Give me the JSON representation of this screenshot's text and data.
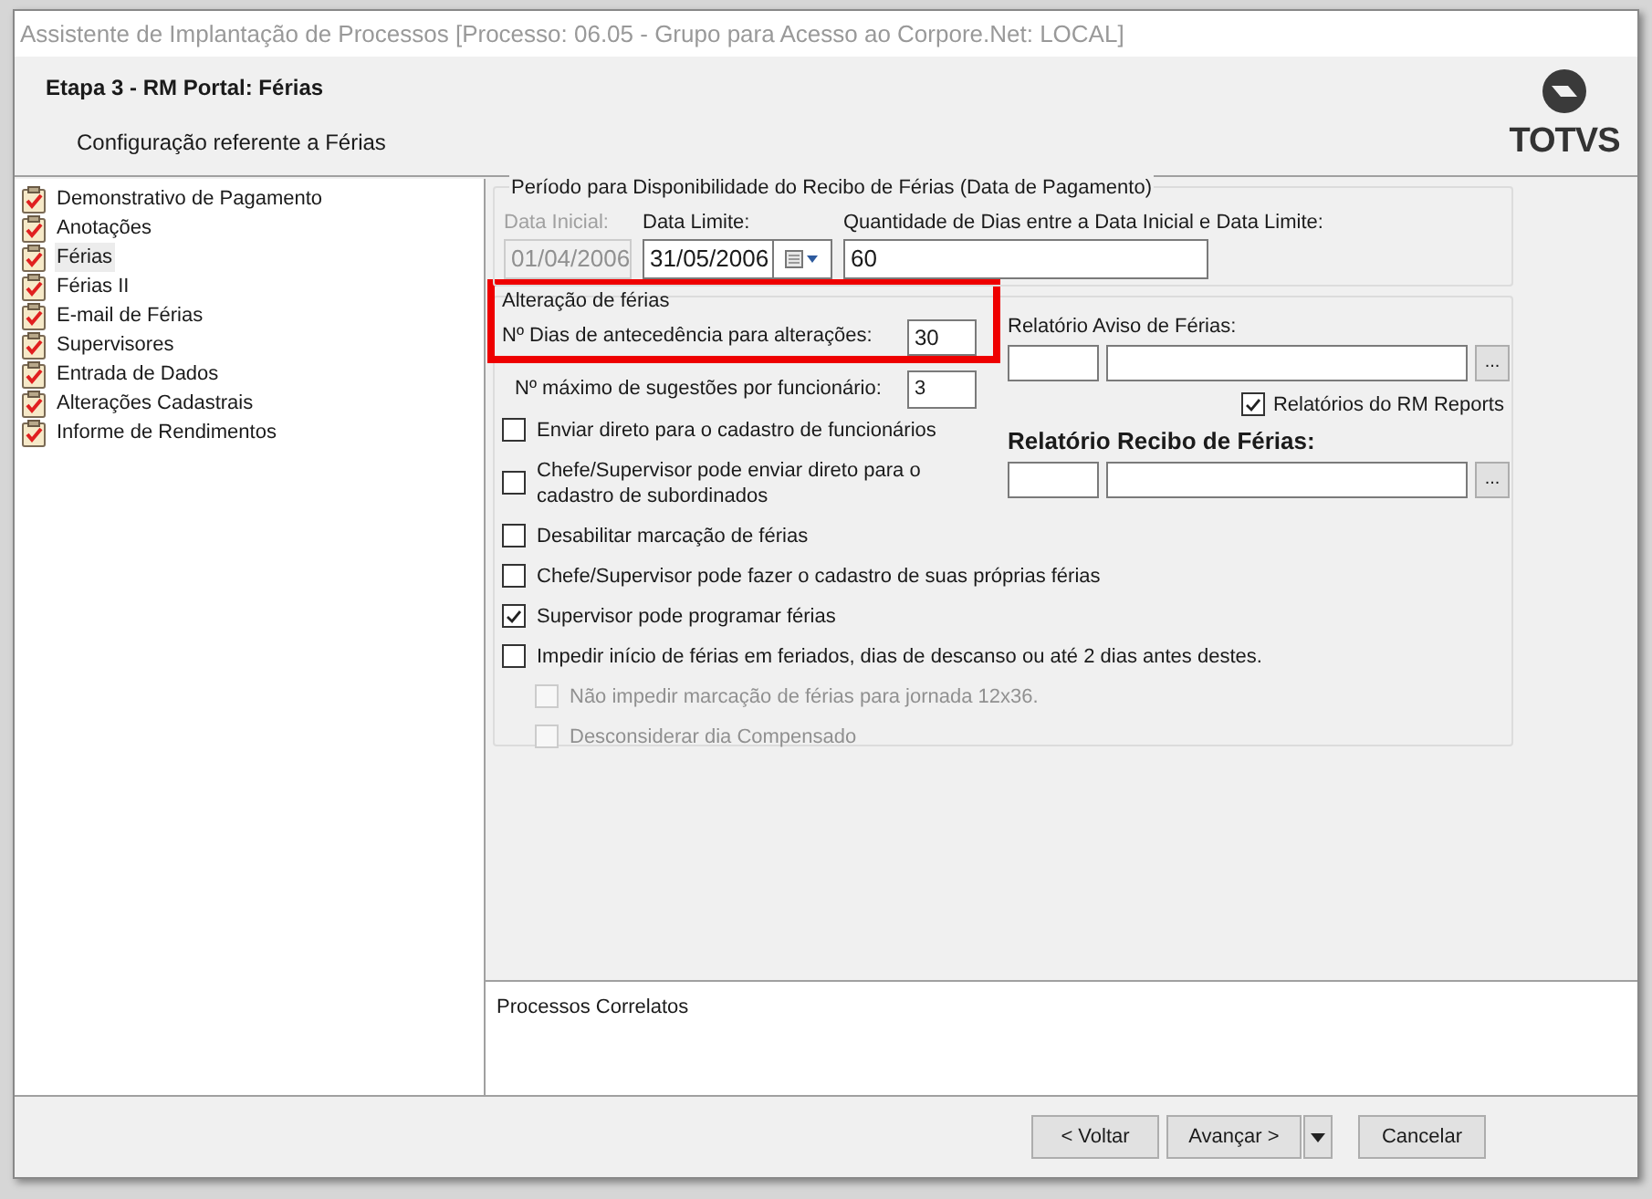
{
  "window": {
    "title": "Assistente de Implantação de Processos [Processo: 06.05 - Grupo para Acesso ao Corpore.Net: LOCAL]"
  },
  "header": {
    "title": "Etapa 3 - RM Portal: Férias",
    "subtitle": "Configuração referente a Férias",
    "logo": "TOTVS"
  },
  "steps": [
    {
      "label": "Demonstrativo de Pagamento",
      "selected": false
    },
    {
      "label": "Anotações",
      "selected": false
    },
    {
      "label": "Férias",
      "selected": true
    },
    {
      "label": "Férias II",
      "selected": false
    },
    {
      "label": "E-mail de Férias",
      "selected": false
    },
    {
      "label": "Supervisores",
      "selected": false
    },
    {
      "label": "Entrada de Dados",
      "selected": false
    },
    {
      "label": "Alterações Cadastrais",
      "selected": false
    },
    {
      "label": "Informe de Rendimentos",
      "selected": false
    }
  ],
  "payment_period": {
    "legend": "Período para Disponibilidade do Recibo de Férias (Data de Pagamento)",
    "fields": [
      {
        "label": "Data Inicial:",
        "value": "01/04/2006",
        "disabled": true,
        "kind": "text"
      },
      {
        "label": "Data Limite:",
        "value": "31/05/2006",
        "disabled": false,
        "kind": "date"
      },
      {
        "label": "Quantidade de Dias entre a Data Inicial e Data Limite:",
        "value": "60",
        "disabled": false,
        "kind": "text"
      }
    ]
  },
  "changes": {
    "legend": "Alteração de férias",
    "advance_days": {
      "label": "Nº Dias de antecedência para alterações:",
      "value": "30"
    },
    "max_suggestions": {
      "label": "Nº máximo de sugestões por funcionário:",
      "value": "3"
    },
    "options": [
      {
        "label": "Enviar direto para o cadastro de funcionários",
        "checked": false,
        "disabled": false
      },
      {
        "label": "Chefe/Supervisor pode enviar direto para o cadastro de subordinados",
        "checked": false,
        "disabled": false
      },
      {
        "label": "Desabilitar marcação de férias",
        "checked": false,
        "disabled": false
      },
      {
        "label": "Chefe/Supervisor pode fazer o cadastro de suas próprias férias",
        "checked": false,
        "disabled": false
      },
      {
        "label": "Supervisor pode programar férias",
        "checked": true,
        "disabled": false
      },
      {
        "label": "Impedir início de férias em feriados, dias de descanso ou até 2 dias antes destes.",
        "checked": false,
        "disabled": false,
        "children": [
          {
            "label": "Não impedir marcação de férias para jornada 12x36.",
            "checked": false,
            "disabled": true
          },
          {
            "label": "Desconsiderar dia Compensado",
            "checked": false,
            "disabled": true
          }
        ]
      }
    ]
  },
  "notice_report": {
    "label": "Relatório Aviso de Férias:",
    "button": "..."
  },
  "rm_reports": {
    "label": "Relatórios do RM Reports",
    "checked": true
  },
  "receipt_report": {
    "label": "Relatório Recibo de Férias:",
    "button": "..."
  },
  "related": {
    "title": "Processos Correlatos"
  },
  "buttons": [
    {
      "label": "< Voltar",
      "kind": "plain"
    },
    {
      "label": "Avançar >",
      "kind": "split"
    },
    {
      "label": "Cancelar",
      "kind": "plain"
    }
  ]
}
